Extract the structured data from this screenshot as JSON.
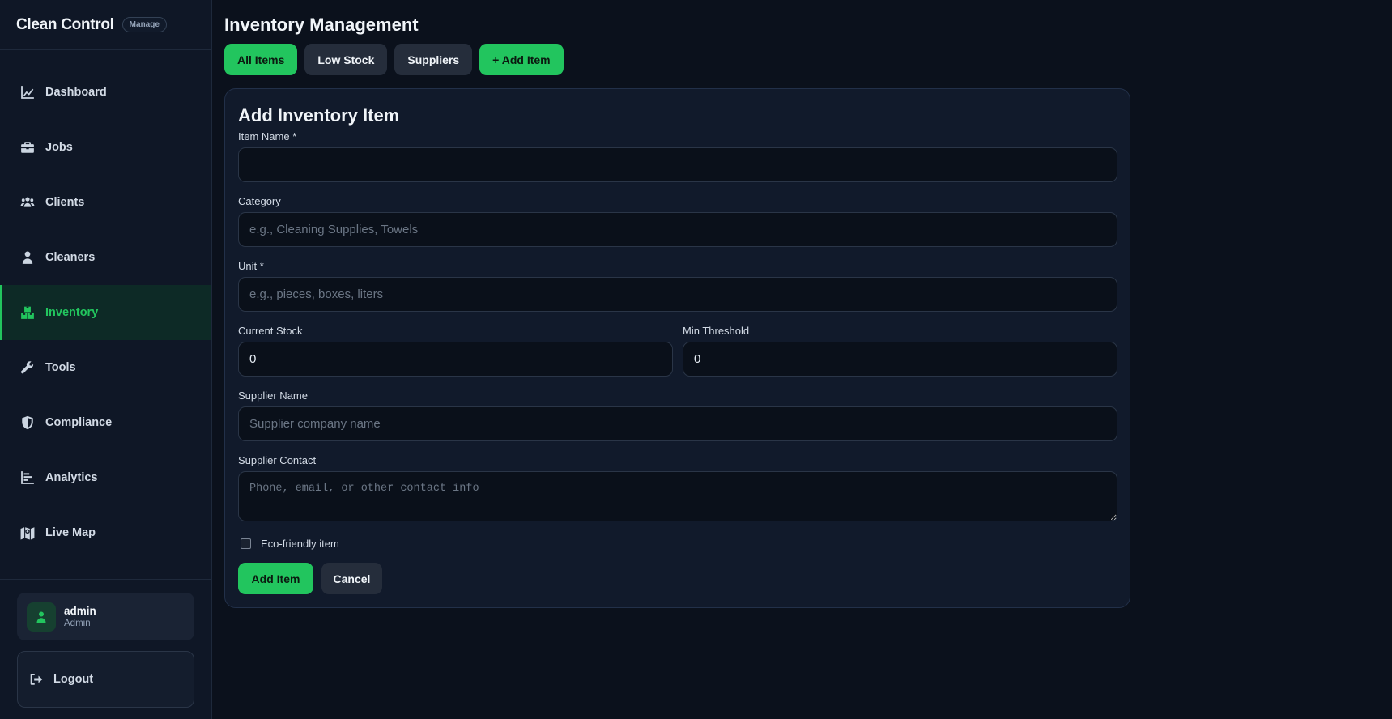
{
  "app": {
    "name": "Clean Control",
    "badge": "Manage"
  },
  "sidebar": {
    "items": [
      {
        "label": "Dashboard",
        "icon": "chart-line-icon"
      },
      {
        "label": "Jobs",
        "icon": "briefcase-icon"
      },
      {
        "label": "Clients",
        "icon": "users-icon"
      },
      {
        "label": "Cleaners",
        "icon": "user-tie-icon"
      },
      {
        "label": "Inventory",
        "icon": "boxes-icon",
        "active": true
      },
      {
        "label": "Tools",
        "icon": "wrench-icon"
      },
      {
        "label": "Compliance",
        "icon": "shield-icon"
      },
      {
        "label": "Analytics",
        "icon": "bar-chart-icon"
      },
      {
        "label": "Live Map",
        "icon": "map-icon"
      }
    ],
    "user": {
      "name": "admin",
      "role": "Admin"
    },
    "logout_label": "Logout"
  },
  "page": {
    "title": "Inventory Management",
    "tabs": [
      {
        "label": "All Items",
        "active": true
      },
      {
        "label": "Low Stock"
      },
      {
        "label": "Suppliers"
      },
      {
        "label": "+ Add Item",
        "primary": true
      }
    ]
  },
  "form": {
    "title": "Add Inventory Item",
    "item_name": {
      "label": "Item Name *",
      "value": "",
      "placeholder": ""
    },
    "category": {
      "label": "Category",
      "value": "",
      "placeholder": "e.g., Cleaning Supplies, Towels"
    },
    "unit": {
      "label": "Unit *",
      "value": "",
      "placeholder": "e.g., pieces, boxes, liters"
    },
    "current_stock": {
      "label": "Current Stock",
      "value": "0"
    },
    "min_threshold": {
      "label": "Min Threshold",
      "value": "0"
    },
    "supplier_name": {
      "label": "Supplier Name",
      "value": "",
      "placeholder": "Supplier company name"
    },
    "supplier_contact": {
      "label": "Supplier Contact",
      "value": "",
      "placeholder": "Phone, email, or other contact info"
    },
    "eco_friendly": {
      "label": "Eco-friendly item",
      "checked": false
    },
    "submit_label": "Add Item",
    "cancel_label": "Cancel"
  },
  "colors": {
    "accent": "#22c55e",
    "background": "#0b111c",
    "sidebar": "#0f1726",
    "card": "#111a2b",
    "active_nav_bg": "#0d2a26"
  }
}
